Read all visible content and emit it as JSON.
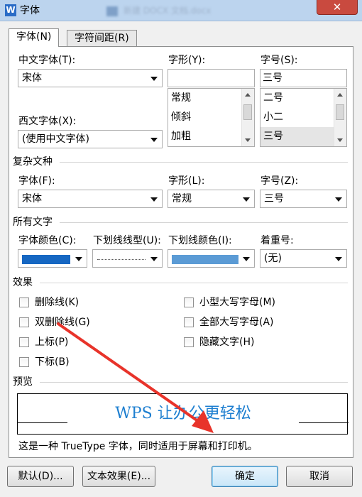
{
  "window": {
    "title": "字体",
    "app_icon": "W",
    "bg_title": "新建 DOCX 文档.docx",
    "close_glyph": "✕"
  },
  "tabs": [
    {
      "label": "字体(N)",
      "active": true
    },
    {
      "label": "字符间距(R)",
      "active": false
    }
  ],
  "chinese_font": {
    "label": "中文字体(T):",
    "value": "宋体"
  },
  "style": {
    "label": "字形(Y):",
    "value": "",
    "options": [
      "常规",
      "倾斜",
      "加粗"
    ]
  },
  "size": {
    "label": "字号(S):",
    "value": "三号",
    "options": [
      "二号",
      "小二",
      "三号"
    ],
    "selected": "三号"
  },
  "western_font": {
    "label": "西文字体(X):",
    "value": "(使用中文字体)"
  },
  "complex": {
    "section_title": "复杂文种",
    "font": {
      "label": "字体(F):",
      "value": "宋体"
    },
    "style": {
      "label": "字形(L):",
      "value": "常规"
    },
    "size": {
      "label": "字号(Z):",
      "value": "三号"
    }
  },
  "all_text": {
    "section_title": "所有文字",
    "font_color": {
      "label": "字体颜色(C):",
      "color": "#1667c2"
    },
    "underline_style": {
      "label": "下划线线型(U):"
    },
    "underline_color": {
      "label": "下划线颜色(I):",
      "color": "#5b9bd5"
    },
    "emphasis": {
      "label": "着重号:",
      "value": "(无)"
    }
  },
  "effects": {
    "section_title": "效果",
    "left": [
      {
        "label": "删除线(K)",
        "checked": false
      },
      {
        "label": "双删除线(G)",
        "checked": false
      },
      {
        "label": "上标(P)",
        "checked": false
      },
      {
        "label": "下标(B)",
        "checked": false
      }
    ],
    "right": [
      {
        "label": "小型大写字母(M)",
        "checked": false
      },
      {
        "label": "全部大写字母(A)",
        "checked": false
      },
      {
        "label": "隐藏文字(H)",
        "checked": false
      }
    ]
  },
  "preview": {
    "section_title": "预览",
    "text": "WPS 让办公更轻松",
    "text_color": "#1e7fd0",
    "note": "这是一种 TrueType 字体，同时适用于屏幕和打印机。"
  },
  "buttons": {
    "default": "默认(D)...",
    "text_effect": "文本效果(E)...",
    "ok": "确定",
    "cancel": "取消"
  },
  "annotation_color": "#e8332a"
}
